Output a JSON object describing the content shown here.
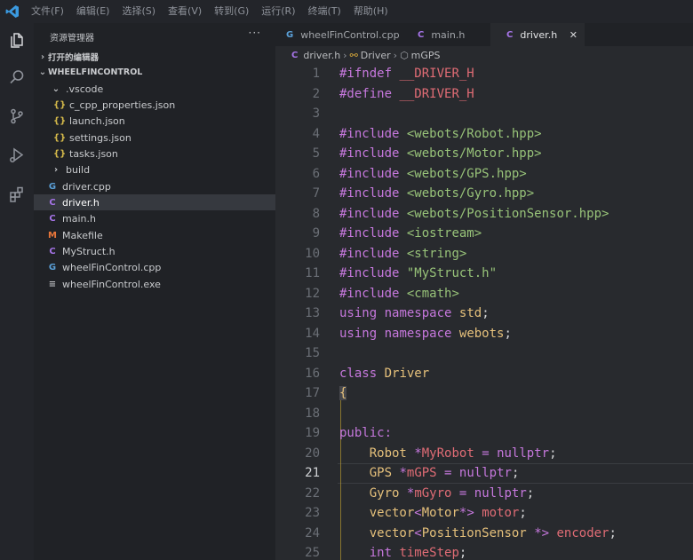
{
  "menu": [
    "文件(F)",
    "编辑(E)",
    "选择(S)",
    "查看(V)",
    "转到(G)",
    "运行(R)",
    "终端(T)",
    "帮助(H)"
  ],
  "sidebar": {
    "title": "资源管理器",
    "more": "···",
    "open_editors": "打开的编辑器",
    "workspace": "WHEELFINCONTROL",
    "files": [
      {
        "name": ".vscode",
        "icon": "chevron-down",
        "glyph": "⌄",
        "color": "#c8cacd"
      },
      {
        "name": "c_cpp_properties.json",
        "icon": "json",
        "glyph": "{}",
        "color": "#d4b94a"
      },
      {
        "name": "launch.json",
        "icon": "json",
        "glyph": "{}",
        "color": "#d4b94a"
      },
      {
        "name": "settings.json",
        "icon": "json",
        "glyph": "{}",
        "color": "#d4b94a"
      },
      {
        "name": "tasks.json",
        "icon": "json",
        "glyph": "{}",
        "color": "#d4b94a"
      },
      {
        "name": "build",
        "icon": "chevron-right",
        "glyph": "›",
        "color": "#c8cacd"
      },
      {
        "name": "driver.cpp",
        "icon": "cpp",
        "glyph": "G",
        "color": "#5aa0d8"
      },
      {
        "name": "driver.h",
        "icon": "c-header",
        "glyph": "C",
        "color": "#a674e8"
      },
      {
        "name": "main.h",
        "icon": "c-header",
        "glyph": "C",
        "color": "#a674e8"
      },
      {
        "name": "Makefile",
        "icon": "makefile",
        "glyph": "M",
        "color": "#e8763a"
      },
      {
        "name": "MyStruct.h",
        "icon": "c-header",
        "glyph": "C",
        "color": "#a674e8"
      },
      {
        "name": "wheelFinControl.cpp",
        "icon": "cpp",
        "glyph": "G",
        "color": "#5aa0d8"
      },
      {
        "name": "wheelFinControl.exe",
        "icon": "exe",
        "glyph": "≡",
        "color": "#b9bbbe"
      }
    ]
  },
  "tabs": [
    {
      "label": "wheelFinControl.cpp",
      "glyph": "G",
      "color": "#5aa0d8"
    },
    {
      "label": "main.h",
      "glyph": "C",
      "color": "#a674e8"
    },
    {
      "label": "driver.h",
      "glyph": "C",
      "color": "#a674e8"
    }
  ],
  "tab_close": "✕",
  "breadcrumb": {
    "file": "driver.h",
    "class": "Driver",
    "member": "mGPS"
  },
  "colors": {
    "accent": "#a674e8",
    "keyword": "#c678dd",
    "string": "#98c379",
    "type": "#e5c07b",
    "variable": "#e06c75"
  },
  "code": {
    "start_line": 1,
    "current_line": 21,
    "lines": [
      [
        [
          "mac",
          "#ifndef"
        ],
        [
          "p",
          " "
        ],
        [
          "var",
          "__DRIVER_H"
        ]
      ],
      [
        [
          "mac",
          "#define"
        ],
        [
          "p",
          " "
        ],
        [
          "var",
          "__DRIVER_H"
        ]
      ],
      [],
      [
        [
          "mac",
          "#include"
        ],
        [
          "p",
          " "
        ],
        [
          "hdr",
          "<webots/Robot.hpp>"
        ]
      ],
      [
        [
          "mac",
          "#include"
        ],
        [
          "p",
          " "
        ],
        [
          "hdr",
          "<webots/Motor.hpp>"
        ]
      ],
      [
        [
          "mac",
          "#include"
        ],
        [
          "p",
          " "
        ],
        [
          "hdr",
          "<webots/GPS.hpp>"
        ]
      ],
      [
        [
          "mac",
          "#include"
        ],
        [
          "p",
          " "
        ],
        [
          "hdr",
          "<webots/Gyro.hpp>"
        ]
      ],
      [
        [
          "mac",
          "#include"
        ],
        [
          "p",
          " "
        ],
        [
          "hdr",
          "<webots/PositionSensor.hpp>"
        ]
      ],
      [
        [
          "mac",
          "#include"
        ],
        [
          "p",
          " "
        ],
        [
          "hdr",
          "<iostream>"
        ]
      ],
      [
        [
          "mac",
          "#include"
        ],
        [
          "p",
          " "
        ],
        [
          "hdr",
          "<string>"
        ]
      ],
      [
        [
          "mac",
          "#include"
        ],
        [
          "p",
          " "
        ],
        [
          "str",
          "\"MyStruct.h\""
        ]
      ],
      [
        [
          "mac",
          "#include"
        ],
        [
          "p",
          " "
        ],
        [
          "hdr",
          "<cmath>"
        ]
      ],
      [
        [
          "kw",
          "using"
        ],
        [
          "p",
          " "
        ],
        [
          "kw",
          "namespace"
        ],
        [
          "p",
          " "
        ],
        [
          "type",
          "std"
        ],
        [
          "p",
          ";"
        ]
      ],
      [
        [
          "kw",
          "using"
        ],
        [
          "p",
          " "
        ],
        [
          "kw",
          "namespace"
        ],
        [
          "p",
          " "
        ],
        [
          "type",
          "webots"
        ],
        [
          "p",
          ";"
        ]
      ],
      [],
      [
        [
          "kw",
          "class"
        ],
        [
          "p",
          " "
        ],
        [
          "type",
          "Driver"
        ]
      ],
      [
        [
          "brace",
          "{"
        ]
      ],
      [],
      [
        [
          "kw",
          "public:"
        ]
      ],
      [
        [
          "p",
          "    "
        ],
        [
          "type",
          "Robot"
        ],
        [
          "p",
          " "
        ],
        [
          "op",
          "*"
        ],
        [
          "var",
          "MyRobot"
        ],
        [
          "p",
          " "
        ],
        [
          "op",
          "="
        ],
        [
          "p",
          " "
        ],
        [
          "kw",
          "nullptr"
        ],
        [
          "p",
          ";"
        ]
      ],
      [
        [
          "p",
          "    "
        ],
        [
          "type",
          "GPS"
        ],
        [
          "p",
          " "
        ],
        [
          "op",
          "*"
        ],
        [
          "var",
          "mGPS"
        ],
        [
          "p",
          " "
        ],
        [
          "op",
          "="
        ],
        [
          "p",
          " "
        ],
        [
          "kw",
          "nullptr"
        ],
        [
          "p",
          ";"
        ]
      ],
      [
        [
          "p",
          "    "
        ],
        [
          "type",
          "Gyro"
        ],
        [
          "p",
          " "
        ],
        [
          "op",
          "*"
        ],
        [
          "var",
          "mGyro"
        ],
        [
          "p",
          " "
        ],
        [
          "op",
          "="
        ],
        [
          "p",
          " "
        ],
        [
          "kw",
          "nullptr"
        ],
        [
          "p",
          ";"
        ]
      ],
      [
        [
          "p",
          "    "
        ],
        [
          "type",
          "vector"
        ],
        [
          "op",
          "<"
        ],
        [
          "type",
          "Motor"
        ],
        [
          "op",
          "*>"
        ],
        [
          "p",
          " "
        ],
        [
          "var",
          "motor"
        ],
        [
          "p",
          ";"
        ]
      ],
      [
        [
          "p",
          "    "
        ],
        [
          "type",
          "vector"
        ],
        [
          "op",
          "<"
        ],
        [
          "type",
          "PositionSensor"
        ],
        [
          "p",
          " "
        ],
        [
          "op",
          "*>"
        ],
        [
          "p",
          " "
        ],
        [
          "var",
          "encoder"
        ],
        [
          "p",
          ";"
        ]
      ],
      [
        [
          "p",
          "    "
        ],
        [
          "kw",
          "int"
        ],
        [
          "p",
          " "
        ],
        [
          "var",
          "timeStep"
        ],
        [
          "p",
          ";"
        ]
      ]
    ]
  }
}
